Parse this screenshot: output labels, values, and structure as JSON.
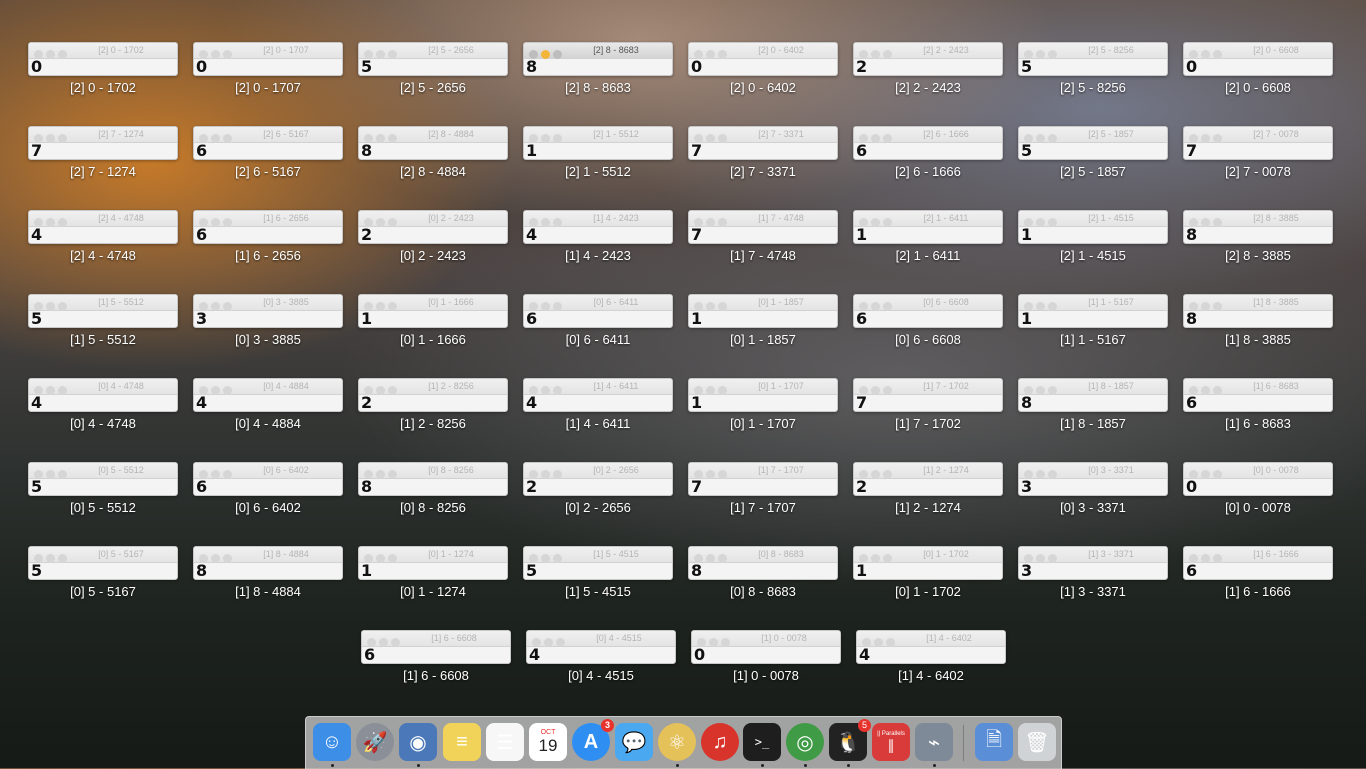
{
  "windows": [
    {
      "digit": "0",
      "title": "[2] 0 - 1702"
    },
    {
      "digit": "0",
      "title": "[2] 0 - 1707"
    },
    {
      "digit": "5",
      "title": "[2] 5 - 2656"
    },
    {
      "digit": "8",
      "title": "[2] 8 - 8683",
      "active": true
    },
    {
      "digit": "0",
      "title": "[2] 0 - 6402"
    },
    {
      "digit": "2",
      "title": "[2] 2 - 2423"
    },
    {
      "digit": "5",
      "title": "[2] 5 - 8256"
    },
    {
      "digit": "0",
      "title": "[2] 0 - 6608"
    },
    {
      "digit": "7",
      "title": "[2] 7 - 1274"
    },
    {
      "digit": "6",
      "title": "[2] 6 - 5167"
    },
    {
      "digit": "8",
      "title": "[2] 8 - 4884"
    },
    {
      "digit": "1",
      "title": "[2] 1 - 5512"
    },
    {
      "digit": "7",
      "title": "[2] 7 - 3371"
    },
    {
      "digit": "6",
      "title": "[2] 6 - 1666"
    },
    {
      "digit": "5",
      "title": "[2] 5 - 1857"
    },
    {
      "digit": "7",
      "title": "[2] 7 - 0078"
    },
    {
      "digit": "4",
      "title": "[2] 4 - 4748"
    },
    {
      "digit": "6",
      "title": "[1] 6 - 2656"
    },
    {
      "digit": "2",
      "title": "[0] 2 - 2423"
    },
    {
      "digit": "4",
      "title": "[1] 4 - 2423"
    },
    {
      "digit": "7",
      "title": "[1] 7 - 4748"
    },
    {
      "digit": "1",
      "title": "[2] 1 - 6411"
    },
    {
      "digit": "1",
      "title": "[2] 1 - 4515"
    },
    {
      "digit": "8",
      "title": "[2] 8 - 3885"
    },
    {
      "digit": "5",
      "title": "[1] 5 - 5512"
    },
    {
      "digit": "3",
      "title": "[0] 3 - 3885"
    },
    {
      "digit": "1",
      "title": "[0] 1 - 1666"
    },
    {
      "digit": "6",
      "title": "[0] 6 - 6411"
    },
    {
      "digit": "1",
      "title": "[0] 1 - 1857"
    },
    {
      "digit": "6",
      "title": "[0] 6 - 6608"
    },
    {
      "digit": "1",
      "title": "[1] 1 - 5167"
    },
    {
      "digit": "8",
      "title": "[1] 8 - 3885"
    },
    {
      "digit": "4",
      "title": "[0] 4 - 4748"
    },
    {
      "digit": "4",
      "title": "[0] 4 - 4884"
    },
    {
      "digit": "2",
      "title": "[1] 2 - 8256"
    },
    {
      "digit": "4",
      "title": "[1] 4 - 6411"
    },
    {
      "digit": "1",
      "title": "[0] 1 - 1707"
    },
    {
      "digit": "7",
      "title": "[1] 7 - 1702"
    },
    {
      "digit": "8",
      "title": "[1] 8 - 1857"
    },
    {
      "digit": "6",
      "title": "[1] 6 - 8683"
    },
    {
      "digit": "5",
      "title": "[0] 5 - 5512"
    },
    {
      "digit": "6",
      "title": "[0] 6 - 6402"
    },
    {
      "digit": "8",
      "title": "[0] 8 - 8256"
    },
    {
      "digit": "2",
      "title": "[0] 2 - 2656"
    },
    {
      "digit": "7",
      "title": "[1] 7 - 1707"
    },
    {
      "digit": "2",
      "title": "[1] 2 - 1274"
    },
    {
      "digit": "3",
      "title": "[0] 3 - 3371"
    },
    {
      "digit": "0",
      "title": "[0] 0 - 0078"
    },
    {
      "digit": "5",
      "title": "[0] 5 - 5167"
    },
    {
      "digit": "8",
      "title": "[1] 8 - 4884"
    },
    {
      "digit": "1",
      "title": "[0] 1 - 1274"
    },
    {
      "digit": "5",
      "title": "[1] 5 - 4515"
    },
    {
      "digit": "8",
      "title": "[0] 8 - 8683"
    },
    {
      "digit": "1",
      "title": "[0] 1 - 1702"
    },
    {
      "digit": "3",
      "title": "[1] 3 - 3371"
    },
    {
      "digit": "6",
      "title": "[1] 6 - 1666"
    },
    {
      "digit": "6",
      "title": "[1] 6 - 6608"
    },
    {
      "digit": "4",
      "title": "[0] 4 - 4515"
    },
    {
      "digit": "0",
      "title": "[1] 0 - 0078"
    },
    {
      "digit": "4",
      "title": "[1] 4 - 6402"
    }
  ],
  "dock": {
    "items": [
      {
        "name": "finder-icon",
        "glyph": "☺",
        "color": "#3d8ee6",
        "running": true
      },
      {
        "name": "launchpad-icon",
        "glyph": "🚀",
        "color": "#8a8f98",
        "running": false
      },
      {
        "name": "network-utility-icon",
        "glyph": "◉",
        "color": "#4a78b8",
        "running": true
      },
      {
        "name": "notes-icon",
        "glyph": "≡",
        "color": "#f1d35a",
        "running": false
      },
      {
        "name": "reminders-icon",
        "glyph": "☰",
        "color": "#f7f7f7",
        "running": false
      },
      {
        "name": "calendar-icon",
        "glyph": "19",
        "color": "#ffffff",
        "running": false,
        "label_top": "OCT"
      },
      {
        "name": "app-store-icon",
        "glyph": "A",
        "color": "#2f8ef2",
        "running": false,
        "badge": "3"
      },
      {
        "name": "messages-icon",
        "glyph": "💬",
        "color": "#4aa8f0",
        "running": false
      },
      {
        "name": "atom-icon",
        "glyph": "⚛",
        "color": "#e5c15a",
        "running": true
      },
      {
        "name": "netease-music-icon",
        "glyph": "♫",
        "color": "#d9342c",
        "running": false
      },
      {
        "name": "terminal-icon",
        "glyph": ">_",
        "color": "#1e1e1e",
        "running": true
      },
      {
        "name": "chrome-icon",
        "glyph": "◎",
        "color": "#3f9b45",
        "running": true
      },
      {
        "name": "qq-icon",
        "glyph": "🐧",
        "color": "#222",
        "running": true,
        "badge": "5"
      },
      {
        "name": "parallels-icon",
        "glyph": "∥",
        "color": "#d93b3b",
        "running": false,
        "label_top": "|| Parallels"
      },
      {
        "name": "rocket-typist-icon",
        "glyph": "⌁",
        "color": "#7f8a99",
        "running": true
      },
      {
        "name": "documents-icon",
        "glyph": "🗎",
        "color": "#5a8ed6",
        "running": false
      },
      {
        "name": "trash-icon",
        "glyph": "🗑",
        "color": "#cfd3d6",
        "running": false
      }
    ]
  }
}
